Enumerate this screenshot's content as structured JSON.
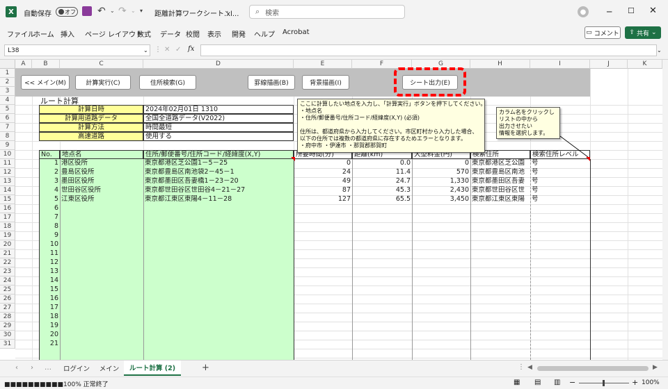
{
  "titlebar": {
    "autosave_label": "自動保存",
    "autosave_state": "オフ",
    "filename": "距離計算ワークシート.xl...",
    "search_placeholder": "検索"
  },
  "menu": [
    "ファイル",
    "ホーム",
    "挿入",
    "ページ レイアウト",
    "数式",
    "データ",
    "校閲",
    "表示",
    "開発",
    "ヘルプ",
    "Acrobat"
  ],
  "comment_btn": "コメント",
  "share_btn": "共有",
  "namebox": "L38",
  "fx": "fx",
  "columns": [
    "A",
    "B",
    "C",
    "D",
    "E",
    "F",
    "G",
    "H",
    "I",
    "J",
    "K"
  ],
  "rows": [
    "1",
    "2",
    "3",
    "4",
    "5",
    "6",
    "7",
    "8",
    "9",
    "10",
    "11",
    "12",
    "13",
    "14",
    "15",
    "16",
    "17",
    "18",
    "19",
    "20",
    "21",
    "22",
    "23",
    "24",
    "25",
    "26",
    "27",
    "28",
    "29",
    "30",
    "31"
  ],
  "buttons": {
    "main": "<< メイン(M)",
    "calc": "計算実行(C)",
    "address": "住所検索(G)",
    "border": "罫線描画(B)",
    "bg": "背景描画(I)",
    "sheet": "シート出力(E)"
  },
  "route_title": "ルート計算",
  "info": [
    {
      "label": "計算日時",
      "value": "2024年02月01日 1310"
    },
    {
      "label": "計算用道路データ",
      "value": "全国全道路データ(V2022)"
    },
    {
      "label": "計算方法",
      "value": "時間最短"
    },
    {
      "label": "高速道路",
      "value": "使用する"
    }
  ],
  "comment1": "ここに計算したい地点を入力し、「計算実行」ボタンを押下してください。\n・地点名\n・住所/郵便番号/住所コード/経緯度(X,Y) (必須)\n\n住所は、都道府県から入力してください。市区町村から入力した場合、\n以下の住所では複数の都道府県に存在するためエラーとなります。\n・府中市 ・伊達市 ・那賀郡那賀町",
  "comment2": "カラム名をクリックし\nリストの中から\n出力させたい\n情報を選択します。",
  "headers": {
    "no": "No.",
    "name": "地点名",
    "addr": "住所/郵便番号/住所コード/経緯度(X,Y)",
    "time": "所要時間(分)",
    "dist": "距離(km)",
    "fee": "大型料金(円)",
    "search_addr": "検索住所",
    "search_level": "検索住所レベル"
  },
  "data_rows": [
    {
      "no": "1",
      "name": "港区役所",
      "addr": "東京都港区芝公園1－5－25",
      "time": "0",
      "dist": "0.0",
      "fee": "0",
      "saddr": "東京都港区芝公園",
      "level": "号"
    },
    {
      "no": "2",
      "name": "豊島区役所",
      "addr": "東京都豊島区南池袋2－45－1",
      "time": "24",
      "dist": "11.4",
      "fee": "570",
      "saddr": "東京都豊島区南池",
      "level": "号"
    },
    {
      "no": "3",
      "name": "墨田区役所",
      "addr": "東京都墨田区吾妻橋1－23－20",
      "time": "49",
      "dist": "24.7",
      "fee": "1,330",
      "saddr": "東京都墨田区吾妻",
      "level": "号"
    },
    {
      "no": "4",
      "name": "世田谷区役所",
      "addr": "東京都世田谷区世田谷4－21－27",
      "time": "87",
      "dist": "45.3",
      "fee": "2,430",
      "saddr": "東京都世田谷区世",
      "level": "号"
    },
    {
      "no": "5",
      "name": "江東区役所",
      "addr": "東京都江東区東陽4－11－28",
      "time": "127",
      "dist": "65.5",
      "fee": "3,450",
      "saddr": "東京都江東区東陽",
      "level": "号"
    }
  ],
  "extra_nos": [
    "6",
    "7",
    "8",
    "9",
    "10",
    "11",
    "12",
    "13",
    "14",
    "15",
    "16",
    "17",
    "18",
    "19",
    "20",
    "21"
  ],
  "sheet_tabs": [
    "ログイン",
    "メイン",
    "ルート計算 (2)"
  ],
  "status": {
    "progress_text": "■■■■■■■■■■100% 正常終了",
    "zoom": "100%"
  },
  "colors": {
    "green": "#ccffcc",
    "yellow": "#ffff99",
    "gray": "#c0c0c0",
    "red": "#ff0000",
    "excel_green": "#1e7145"
  }
}
